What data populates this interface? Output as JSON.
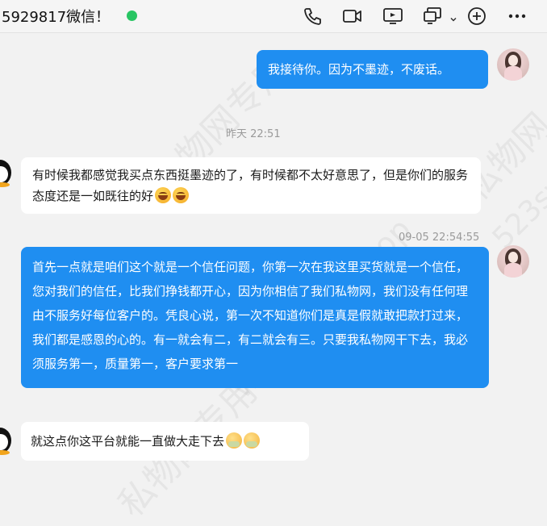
{
  "header": {
    "title": "5929817微信！",
    "status_color": "#28c563",
    "icons": [
      "phone-icon",
      "video-camera-icon",
      "screen-share-icon",
      "remote-desktop-icon",
      "chevron-down-icon",
      "add-circle-icon",
      "more-icon"
    ]
  },
  "messages": [
    {
      "side": "out",
      "text": "我接待你。因为不墨迹，不废话。"
    },
    {
      "side": "in",
      "text": "有时候我都感觉我买点东西挺墨迹的了，有时候都不太好意思了，但是你们的服务态度还是一如既往的好"
    },
    {
      "side": "out",
      "text": "首先一点就是咱们这个就是一个信任问题，你第一次在我这里买货就是一个信任，您对我们的信任，比我们挣钱都开心，因为你相信了我们私物网，我们没有任何理由不服务好每位客户的。凭良心说，第一次不知道你们是真是假就敢把款打过来，我们都是感恩的心的。有一就会有二，有二就会有三。只要我私物网干下去，我必须服务第一，质量第一，客户要求第一"
    },
    {
      "side": "in",
      "text": "就这点你这平台就能一直做大走下去"
    }
  ],
  "timestamps": {
    "t1": "昨天 22:51",
    "t2": "09-05 22:54:55"
  },
  "watermark": {
    "w1": "私物网专用",
    "w2": "www.523sw.top",
    "w3": "私物网",
    "w4": "523sw"
  },
  "colors": {
    "outgoing_bubble": "#1f8ef1",
    "incoming_bubble": "#ffffff",
    "background": "#f2f2f2"
  }
}
